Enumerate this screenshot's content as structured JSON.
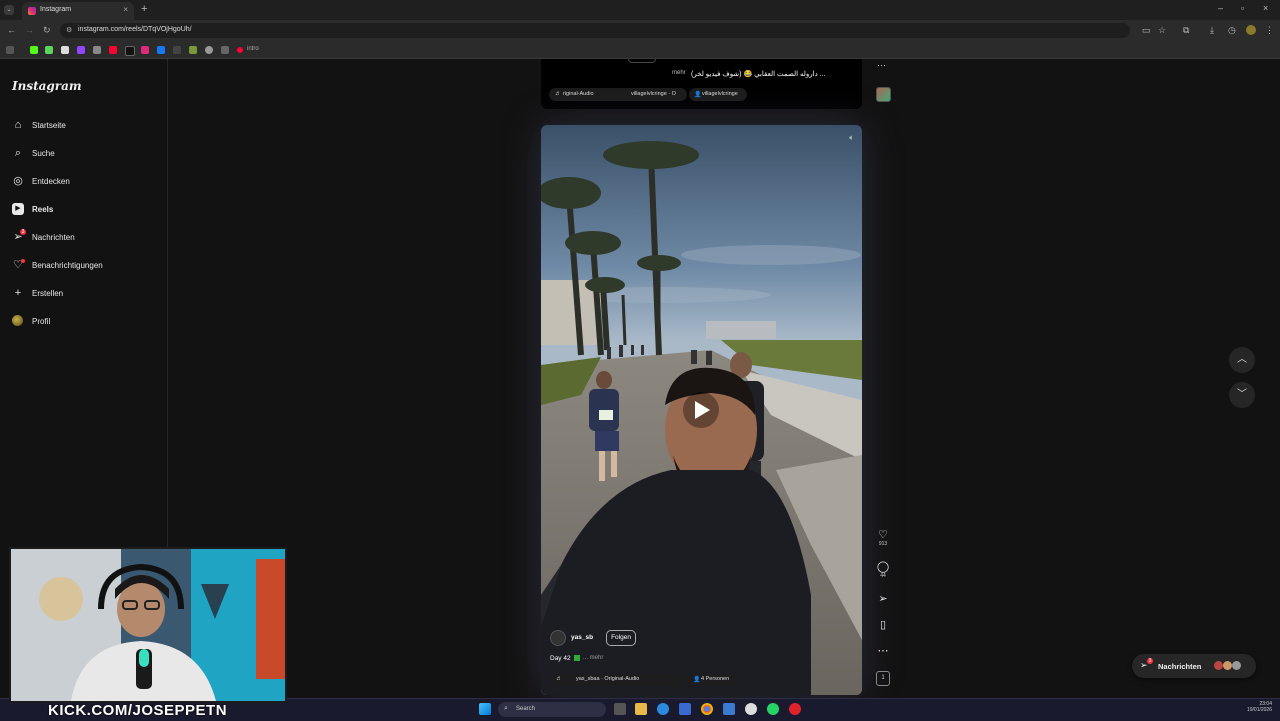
{
  "browser": {
    "tab_title": "Instagram",
    "tab_close": "×",
    "new_tab": "+",
    "url": "instagram.com/reels/DTqVOjHgoUh/",
    "window_controls": [
      "–",
      "▫",
      "×"
    ],
    "bookmark_label": "intro"
  },
  "sidebar": {
    "logo": "Instagram",
    "items": [
      {
        "label": "Startseite",
        "icon": "home-icon"
      },
      {
        "label": "Suche",
        "icon": "search-icon"
      },
      {
        "label": "Entdecken",
        "icon": "compass-icon"
      },
      {
        "label": "Reels",
        "icon": "reels-icon"
      },
      {
        "label": "Nachrichten",
        "icon": "messenger-icon",
        "badge": "3"
      },
      {
        "label": "Benachrichtigungen",
        "icon": "heart-icon"
      },
      {
        "label": "Erstellen",
        "icon": "plus-icon"
      },
      {
        "label": "Profil",
        "icon": "avatar"
      }
    ]
  },
  "prev_reel": {
    "caption_more": "mehr",
    "caption": "... داروله الصمت العقابي 😂 (شوف فيديو لخر)",
    "audio": "riginal-Audio",
    "audio2": "villagelvlcringe · O",
    "collab": "villagelvlcringe"
  },
  "reel": {
    "username": "yas_sb",
    "follow_label": "Folgen",
    "caption": "Day 42",
    "caption_more": "... mehr",
    "audio": "yas_sbaa · Original-Audio",
    "people": "4 Personen"
  },
  "actions": {
    "likes": "913",
    "comments": "44"
  },
  "messages": {
    "label": "Nachrichten",
    "badge": "3"
  },
  "stream": {
    "overlay": "KICK.COM/JOSEPPETN"
  },
  "taskbar": {
    "search": "Search",
    "time": "23:04",
    "date": "19/01/2026"
  },
  "colors": {
    "background": "#121212",
    "sidebar_border": "#262626",
    "badge": "#ff3040",
    "kick_green": "#53fc18"
  }
}
